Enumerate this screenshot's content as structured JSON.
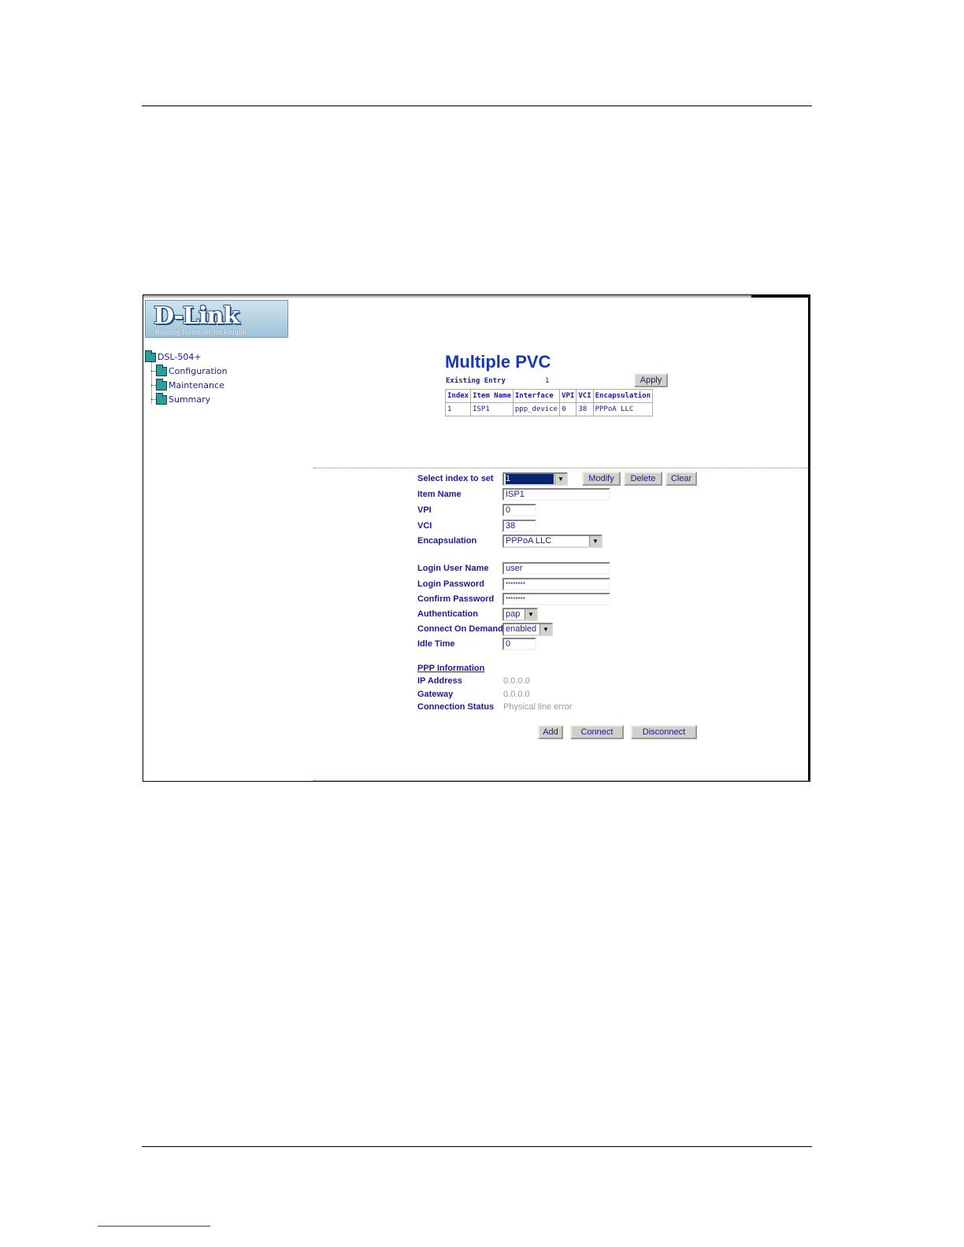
{
  "logo": {
    "brand": "D-Link",
    "tagline": "Building Networks for People"
  },
  "tree": {
    "root": "DSL-504+",
    "items": [
      "Configuration",
      "Maintenance",
      "Summary"
    ]
  },
  "page": {
    "title": "Multiple PVC",
    "existing_entry_label": "Existing Entry",
    "existing_entry_value": "1",
    "apply_label": "Apply"
  },
  "table": {
    "headers": [
      "Index",
      "Item Name",
      "Interface",
      "VPI",
      "VCI",
      "Encapsulation"
    ],
    "rows": [
      [
        "1",
        "ISP1",
        "ppp_device",
        "0",
        "38",
        "PPPoA LLC"
      ]
    ]
  },
  "form": {
    "select_index_label": "Select index to set",
    "select_index_value": "1",
    "modify_label": "Modify",
    "delete_label": "Delete",
    "clear_label": "Clear",
    "item_name_label": "Item Name",
    "item_name_value": "ISP1",
    "vpi_label": "VPI",
    "vpi_value": "0",
    "vci_label": "VCI",
    "vci_value": "38",
    "encapsulation_label": "Encapsulation",
    "encapsulation_value": "PPPoA LLC",
    "login_user_label": "Login User Name",
    "login_user_value": "user",
    "login_password_label": "Login Password",
    "login_password_value": "********",
    "confirm_password_label": "Confirm Password",
    "confirm_password_value": "********",
    "authentication_label": "Authentication",
    "authentication_value": "pap",
    "connect_on_demand_label": "Connect On Demand",
    "connect_on_demand_value": "enabled",
    "idle_time_label": "Idle Time",
    "idle_time_value": "0"
  },
  "ppp": {
    "heading": "PPP Information",
    "ip_label": "IP Address",
    "ip_value": "0.0.0.0",
    "gateway_label": "Gateway",
    "gateway_value": "0.0.0.0",
    "status_label": "Connection Status",
    "status_value": "Physical line error"
  },
  "actions": {
    "add_label": "Add",
    "connect_label": "Connect",
    "disconnect_label": "Disconnect"
  }
}
